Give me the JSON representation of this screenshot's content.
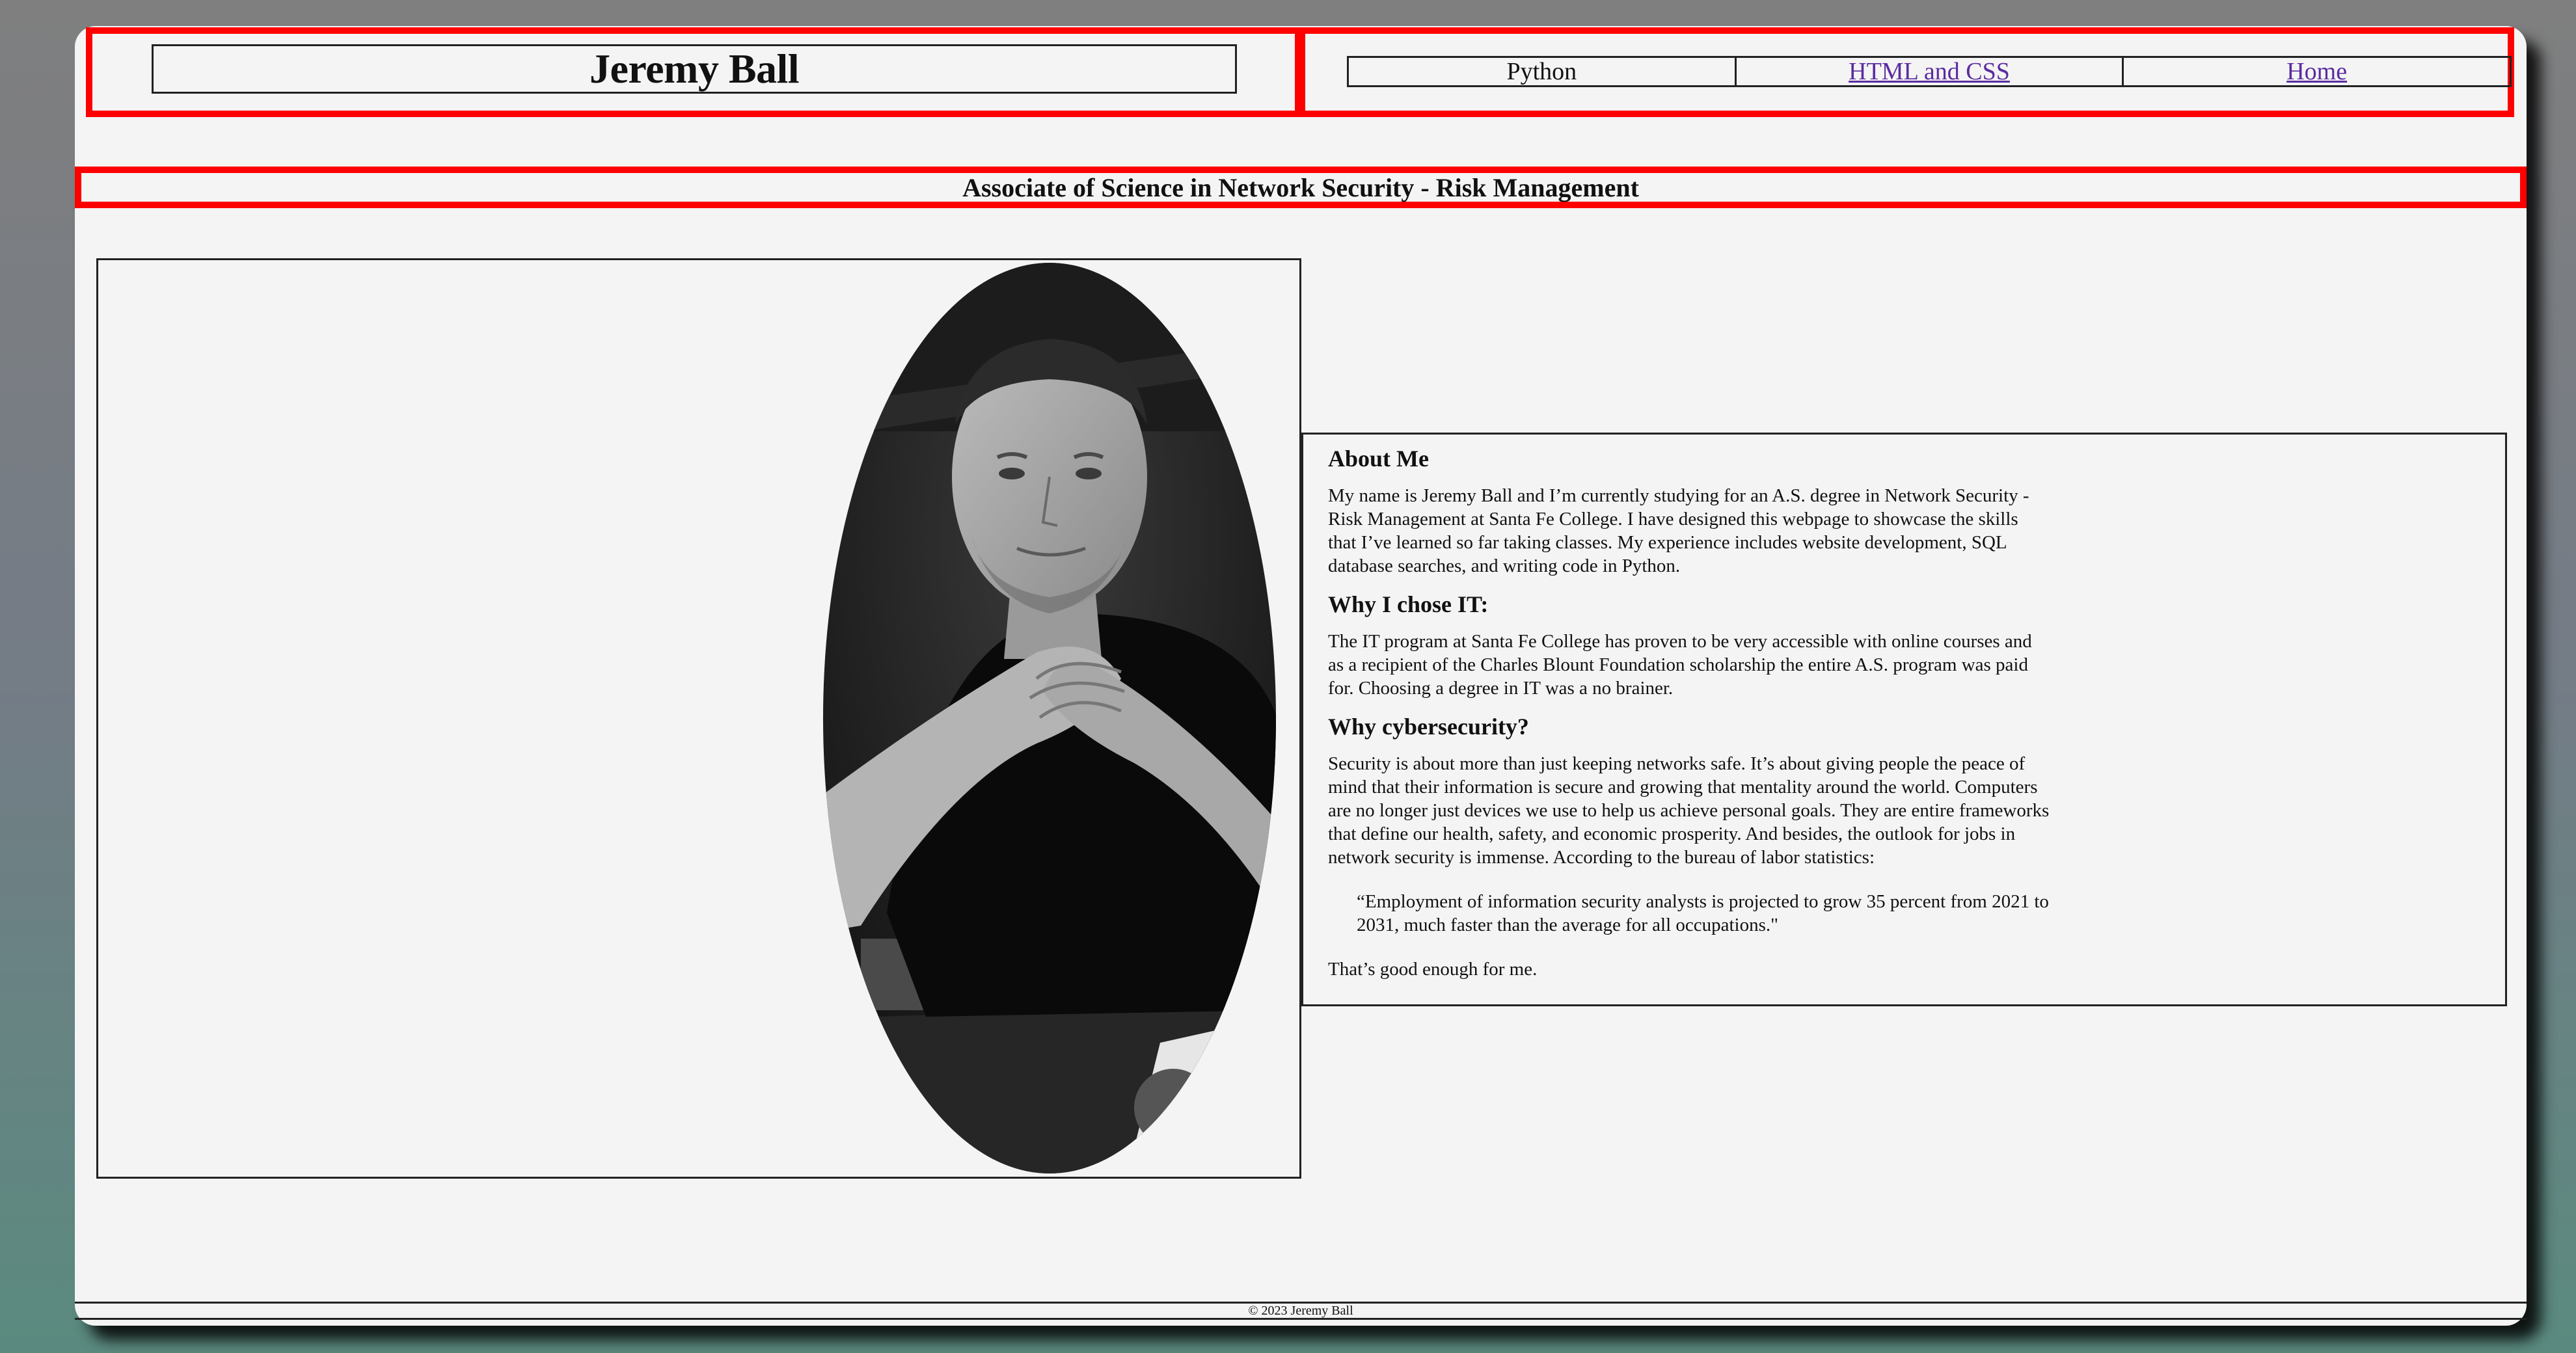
{
  "header": {
    "name": "Jeremy Ball"
  },
  "nav": {
    "items": [
      {
        "label": "Python"
      },
      {
        "label": "HTML and CSS"
      },
      {
        "label": "Home"
      }
    ]
  },
  "subtitle": "Associate of Science in Network Security - Risk Management",
  "about": {
    "heading": "About Me",
    "text": "My name is Jeremy Ball and I’m currently studying for an A.S. degree in Network Security - Risk Management at Santa Fe College. I have designed this webpage to showcase the skills that I’ve learned so far taking classes. My experience includes website development, SQL database searches, and writing code in Python."
  },
  "why_it": {
    "heading": "Why I chose IT:",
    "text": "The IT program at Santa Fe College has proven to be very accessible with online courses and as a recipient of the Charles Blount Foundation scholarship the entire A.S. program was paid for. Choosing a degree in IT was a no brainer."
  },
  "why_cyber": {
    "heading": "Why cybersecurity?",
    "text": "Security is about more than just keeping networks safe. It’s about giving people the peace of mind that their information is secure and growing that mentality around the world. Computers are no longer just devices we use to help us achieve personal goals. They are entire frameworks that define our health, safety, and economic prosperity. And besides, the outlook for jobs in network security is immense. According to the bureau of labor statistics:",
    "quote": "“Employment of information security analysts is projected to grow 35 percent from 2021 to 2031, much faster than the average for all occupations.\"",
    "closing": "That’s good enough for me."
  },
  "footer": {
    "text": "© 2023 Jeremy Ball"
  },
  "colors": {
    "highlight": "#ff0000",
    "link": "#5b2ca0",
    "page_bg": "#f4f4f4"
  }
}
